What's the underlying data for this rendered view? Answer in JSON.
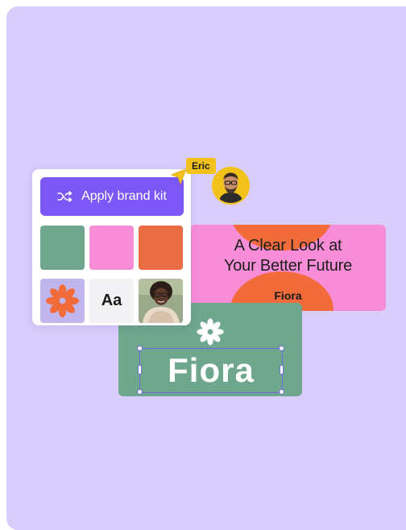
{
  "brand_kit": {
    "apply_label": "Apply brand kit",
    "swatches": [
      "#6fa78e",
      "#f78dd7",
      "#e96c42"
    ],
    "font_sample": "Aa"
  },
  "banner": {
    "headline_line1": "A Clear Look at",
    "headline_line2": "Your Better Future",
    "brand": "Fiora"
  },
  "green_card": {
    "word": "Fiora"
  },
  "collaborator": {
    "name": "Eric"
  },
  "colors": {
    "canvas_bg": "#d9cdfc",
    "accent_purple": "#7b58f5",
    "green": "#6fa78e",
    "pink": "#f78dd7",
    "orange": "#f26b3a",
    "tag_yellow": "#f3c21a"
  }
}
